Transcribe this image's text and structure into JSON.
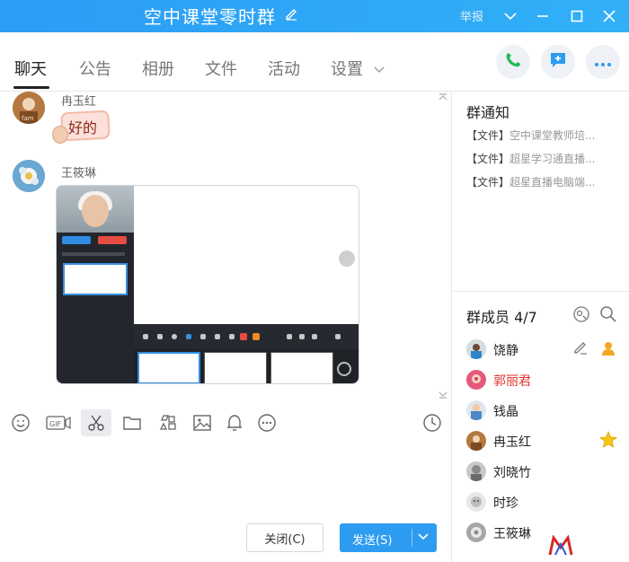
{
  "window": {
    "title": "空中课堂零时群",
    "report": "举报"
  },
  "tabs": [
    {
      "label": "聊天"
    },
    {
      "label": "公告"
    },
    {
      "label": "相册"
    },
    {
      "label": "文件"
    },
    {
      "label": "活动"
    },
    {
      "label": "设置"
    }
  ],
  "chat": {
    "messages": [
      {
        "sender": "冉玉红",
        "sticker_text": "好的"
      },
      {
        "sender": "王筱琳"
      }
    ]
  },
  "actions": {
    "close_label": "关闭(C)",
    "send_label": "发送(S)"
  },
  "notice": {
    "title": "群通知",
    "items": [
      {
        "prefix": "【文件】",
        "text": "空中课堂教师培..."
      },
      {
        "prefix": "【文件】",
        "text": "超星学习通直播..."
      },
      {
        "prefix": "【文件】",
        "text": "超星直播电脑端..."
      }
    ]
  },
  "members": {
    "title": "群成员 4/7",
    "list": [
      {
        "name": "饶静"
      },
      {
        "name": "郭丽君"
      },
      {
        "name": "钱晶"
      },
      {
        "name": "冉玉红"
      },
      {
        "name": "刘晓竹"
      },
      {
        "name": "时珍"
      },
      {
        "name": "王筱琳"
      }
    ]
  },
  "colors": {
    "titlebar": "#2c9cf5",
    "send_button": "#2d9cf0",
    "highlight_name": "#e1332c"
  }
}
